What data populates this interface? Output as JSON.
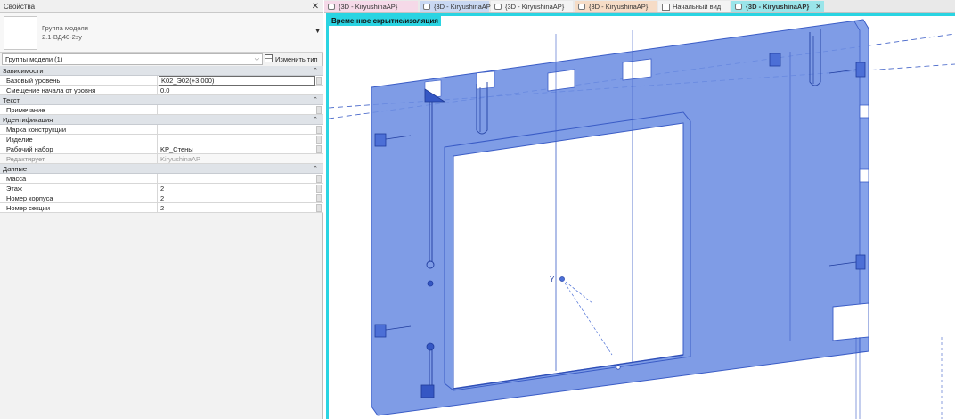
{
  "properties": {
    "title": "Свойства",
    "close": "✕",
    "type_name_line1": "Группа модели",
    "type_name_line2": "2.1-ВД40-2зу",
    "filter": "Группы модели (1)",
    "edit_type": "Изменить тип",
    "sections": {
      "constraints": "Зависимости",
      "text": "Текст",
      "identity": "Идентификация",
      "data": "Данные"
    },
    "rows": {
      "base_level": {
        "label": "Базовый уровень",
        "value": "K02_Э02(+3.000)"
      },
      "origin_offset": {
        "label": "Смещение начала от уровня",
        "value": "0.0"
      },
      "comments": {
        "label": "Примечание",
        "value": ""
      },
      "mark": {
        "label": "Марка конструкции",
        "value": ""
      },
      "item": {
        "label": "Изделие",
        "value": ""
      },
      "workset": {
        "label": "Рабочий набор",
        "value": "KP_Стены"
      },
      "edited_by": {
        "label": "Редактирует",
        "value": "KiryushinaAP"
      },
      "mass": {
        "label": "Масса",
        "value": ""
      },
      "floor": {
        "label": "Этаж",
        "value": "2"
      },
      "building_no": {
        "label": "Номер корпуса",
        "value": "2"
      },
      "section_no": {
        "label": "Номер секции",
        "value": "2"
      }
    }
  },
  "tabs": [
    {
      "label": "{3D - KiryushinaAP}",
      "color": "#f5d9e8"
    },
    {
      "label": "{3D - KiryushinaAP}",
      "color": "#c9d8f2"
    },
    {
      "label": "{3D - KiryushinaAP}",
      "color": "#f3f3f3"
    },
    {
      "label": "{3D - KiryushinaAP}",
      "color": "#f6dcc6"
    },
    {
      "label": "Начальный вид",
      "color": "#f3f3f3"
    },
    {
      "label": "{3D - KiryushinaAP}",
      "color": "#9ae5ea",
      "close": "✕"
    }
  ],
  "view": {
    "temp_hide_label": "Временное скрытие/изоляция",
    "origin_axis_label": "Y",
    "colors": {
      "highlight": "#2ad4e2",
      "panel_fill": "#6d8ee2",
      "panel_stroke": "#3a5cc6"
    }
  }
}
